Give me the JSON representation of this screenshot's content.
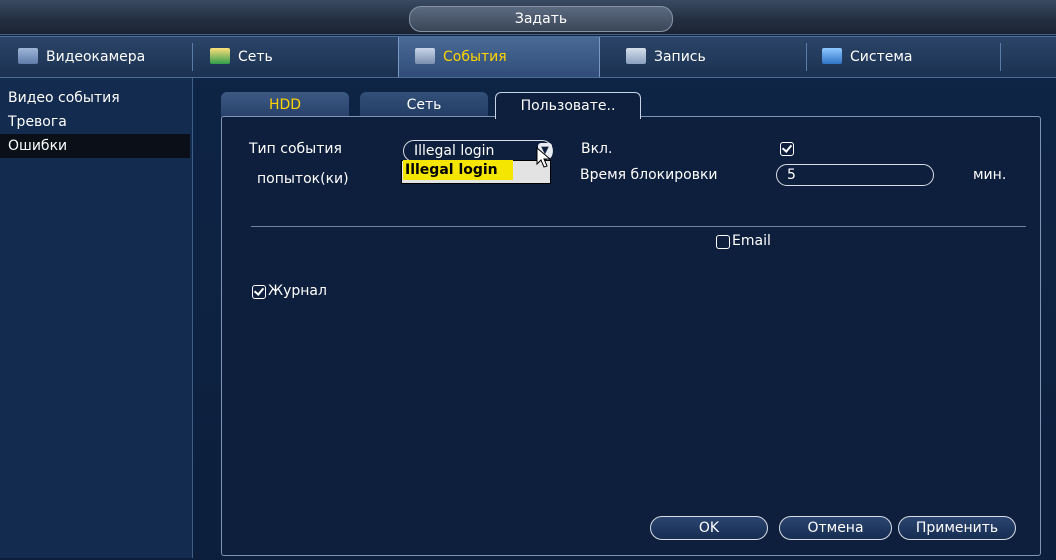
{
  "window": {
    "title": "Задать"
  },
  "nav": {
    "items": [
      {
        "label": "Видеокамера",
        "icon": "camera-icon"
      },
      {
        "label": "Сеть",
        "icon": "network-icon"
      },
      {
        "label": "События",
        "icon": "events-icon",
        "active": true
      },
      {
        "label": "Запись",
        "icon": "record-icon"
      },
      {
        "label": "Система",
        "icon": "system-icon"
      }
    ]
  },
  "sidebar": {
    "items": [
      {
        "label": "Видео события"
      },
      {
        "label": "Тревога"
      },
      {
        "label": "Ошибки",
        "active": true
      }
    ]
  },
  "tabs": [
    {
      "label": "HDD"
    },
    {
      "label": "Сеть"
    },
    {
      "label": "Пользовате..",
      "active": true
    }
  ],
  "form": {
    "event_type_label": "Тип события",
    "event_type_value": "Illegal login",
    "dropdown_option": "Illegal login",
    "attempts_label": "попыток(ки)",
    "enable_label": "Вкл.",
    "enable_checked": true,
    "lock_time_label": "Время блокировки",
    "lock_time_value": "5",
    "lock_time_unit": "мин.",
    "email_label": "Email",
    "email_checked": false,
    "log_label": "Журнал",
    "log_checked": true
  },
  "buttons": {
    "ok": "OK",
    "cancel": "Отмена",
    "apply": "Применить"
  },
  "colors": {
    "active_tab_text": "#ffd400",
    "dropdown_highlight": "#f5e600"
  }
}
